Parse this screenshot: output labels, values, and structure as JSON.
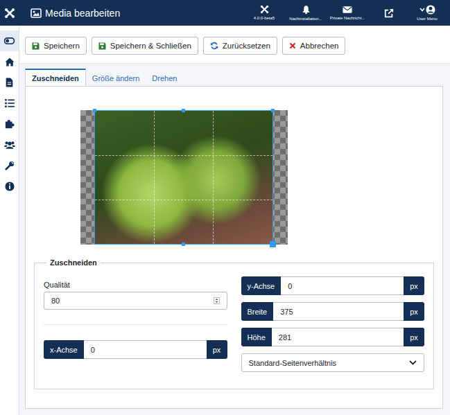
{
  "header": {
    "title": "Media bearbeiten",
    "items": [
      {
        "kind": "version",
        "label": "4.0.0-beta5"
      },
      {
        "kind": "notifications",
        "label": "Nachinstallation..."
      },
      {
        "kind": "messages",
        "label": "Private Nachricht..."
      },
      {
        "kind": "site"
      },
      {
        "kind": "user",
        "label": "User Menu"
      }
    ]
  },
  "sidebar": {
    "items": [
      {
        "kind": "toggle",
        "selected": true
      },
      {
        "kind": "home",
        "selected": false
      },
      {
        "kind": "content",
        "selected": false
      },
      {
        "kind": "menus",
        "selected": false
      },
      {
        "kind": "components",
        "selected": false
      },
      {
        "kind": "users",
        "selected": false
      },
      {
        "kind": "system",
        "selected": false
      },
      {
        "kind": "help",
        "selected": false
      }
    ]
  },
  "toolbar": {
    "buttons": [
      {
        "kind": "save",
        "label": "Speichern"
      },
      {
        "kind": "save",
        "label": "Speichern & Schließen"
      },
      {
        "kind": "reset",
        "label": "Zurücksetzen"
      },
      {
        "kind": "cancel",
        "label": "Abbrechen"
      }
    ]
  },
  "tabs": [
    {
      "label": "Zuschneiden",
      "selected": true
    },
    {
      "label": "Größe ändern",
      "selected": false
    },
    {
      "label": "Drehen",
      "selected": false
    }
  ],
  "crop_form": {
    "legend": "Zuschneiden",
    "quality": {
      "label": "Qualität",
      "value": "80"
    },
    "left_fields": [
      {
        "label": "x-Achse",
        "value": "0",
        "unit": "px"
      }
    ],
    "right_fields": [
      {
        "label": "y-Achse",
        "value": "0",
        "unit": "px"
      },
      {
        "label": "Breite",
        "value": "375",
        "unit": "px"
      },
      {
        "label": "Höhe",
        "value": "281",
        "unit": "px"
      }
    ],
    "aspect": {
      "value": "Standard-Seitenverhältnis"
    }
  }
}
